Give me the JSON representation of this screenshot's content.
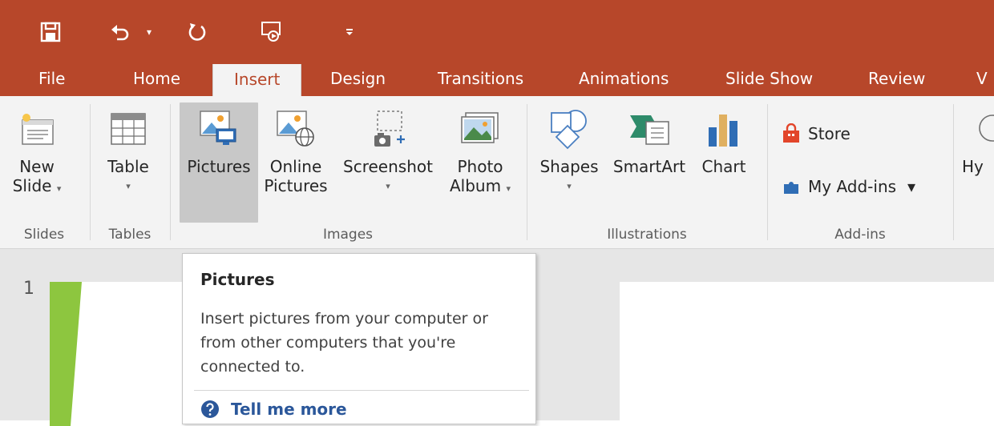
{
  "colors": {
    "accent": "#b7472a",
    "ribbon_bg": "#f3f3f3",
    "link": "#2b579a",
    "thumb_accent": "#8dc63f"
  },
  "qat": {
    "save_icon": "save-icon",
    "undo_icon": "undo-icon",
    "redo_icon": "repeat-icon",
    "present_icon": "start-from-beginning-icon",
    "customize_icon": "customize-qat-icon"
  },
  "tabs": [
    {
      "label": "File"
    },
    {
      "label": "Home"
    },
    {
      "label": "Insert",
      "active": true
    },
    {
      "label": "Design"
    },
    {
      "label": "Transitions"
    },
    {
      "label": "Animations"
    },
    {
      "label": "Slide Show"
    },
    {
      "label": "Review"
    },
    {
      "label": "V"
    }
  ],
  "ribbon": {
    "groups": {
      "slides": "Slides",
      "tables": "Tables",
      "images": "Images",
      "illustrations": "Illustrations",
      "addins": "Add-ins"
    },
    "buttons": {
      "new_slide_1": "New",
      "new_slide_2": "Slide",
      "table": "Table",
      "pictures": "Pictures",
      "online_pictures_1": "Online",
      "online_pictures_2": "Pictures",
      "screenshot": "Screenshot",
      "photo_album_1": "Photo",
      "photo_album_2": "Album",
      "shapes": "Shapes",
      "smartart": "SmartArt",
      "chart": "Chart",
      "store": "Store",
      "my_addins": "My Add-ins",
      "hyperlink_partial": "Hy"
    },
    "caret": "▾"
  },
  "slides": {
    "current_number": "1"
  },
  "tooltip": {
    "title": "Pictures",
    "body": "Insert pictures from your computer or from other computers that you're connected to.",
    "link": "Tell me more"
  }
}
